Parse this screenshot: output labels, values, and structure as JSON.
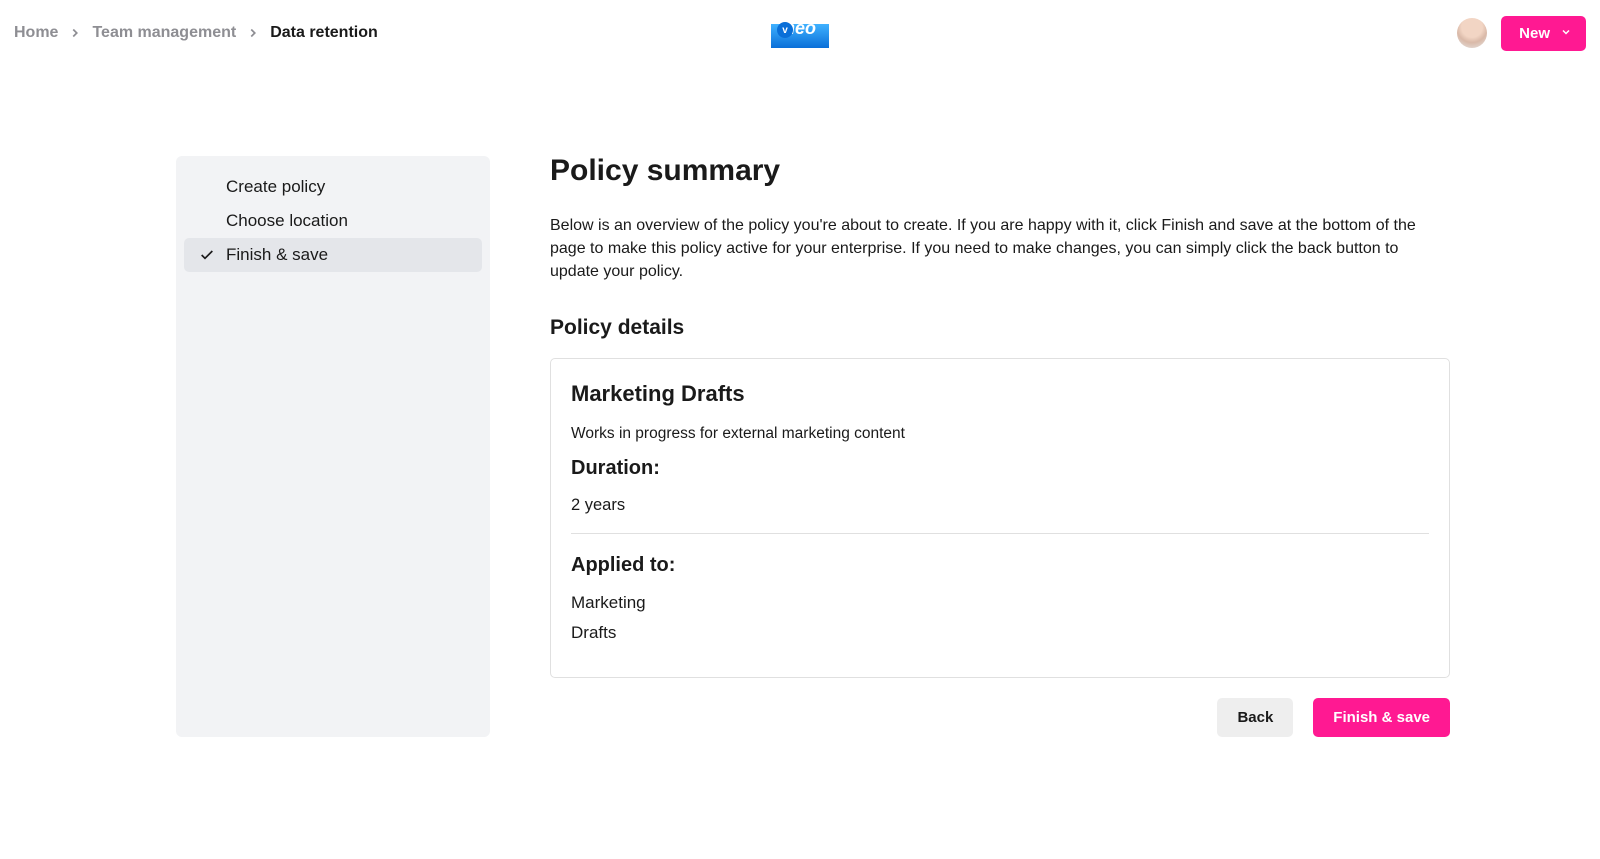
{
  "breadcrumb": {
    "items": [
      {
        "label": "Home",
        "current": false
      },
      {
        "label": "Team management",
        "current": false
      },
      {
        "label": "Data retention",
        "current": true
      }
    ]
  },
  "header": {
    "new_button": "New",
    "logo_text": "neo"
  },
  "sidebar": {
    "items": [
      {
        "label": "Create policy",
        "active": false
      },
      {
        "label": "Choose location",
        "active": false
      },
      {
        "label": "Finish & save",
        "active": true
      }
    ]
  },
  "main": {
    "title": "Policy summary",
    "intro": "Below is an overview of the policy you're about to create. If you are happy with it, click Finish and save at the bottom of the page to make this policy active for your enterprise. If you need to make changes, you can simply click the back button to update your policy.",
    "details_heading": "Policy details",
    "policy": {
      "name": "Marketing Drafts",
      "description": "Works in progress for external marketing content",
      "duration_label": "Duration:",
      "duration_value": "2 years",
      "applied_label": "Applied to:",
      "applied": [
        "Marketing",
        "Drafts"
      ]
    },
    "back_button": "Back",
    "finish_button": "Finish & save"
  }
}
